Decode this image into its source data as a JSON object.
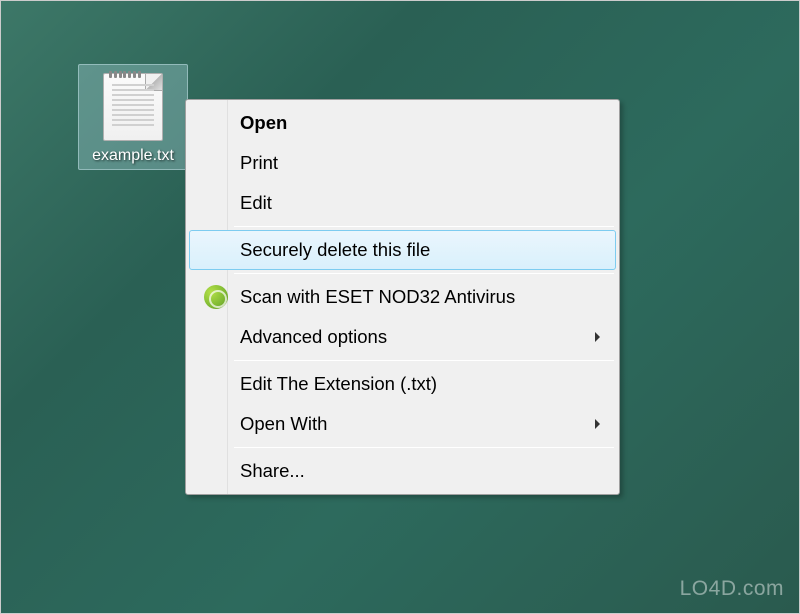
{
  "desktop": {
    "file_label": "example.txt"
  },
  "context_menu": {
    "items": {
      "open": "Open",
      "print": "Print",
      "edit": "Edit",
      "securely_delete": "Securely delete this file",
      "scan_eset": "Scan with ESET NOD32 Antivirus",
      "advanced_options": "Advanced options",
      "edit_extension": "Edit The Extension (.txt)",
      "open_with": "Open With",
      "share": "Share..."
    }
  },
  "watermark": "LO4D.com"
}
